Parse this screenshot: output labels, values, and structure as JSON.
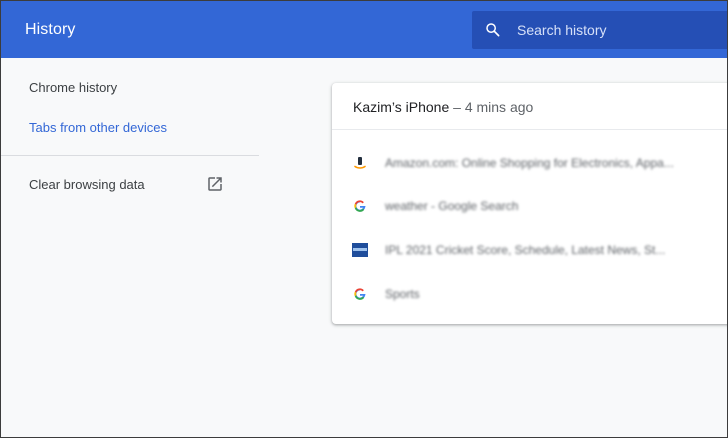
{
  "header": {
    "title": "History",
    "search_placeholder": "Search history"
  },
  "sidebar": {
    "items": [
      {
        "label": "Chrome history",
        "selected": false
      },
      {
        "label": "Tabs from other devices",
        "selected": true
      },
      {
        "label": "Clear browsing data",
        "icon": "open-in-new-icon"
      }
    ]
  },
  "device": {
    "name": "Kazim’s iPhone",
    "time": " – 4 mins ago",
    "tabs": [
      {
        "title": "Amazon.com: Online Shopping for Electronics, Appa...",
        "icon": "amazon-favicon"
      },
      {
        "title": "weather - Google Search",
        "icon": "google-favicon"
      },
      {
        "title": "IPL 2021 Cricket Score, Schedule, Latest News, St...",
        "icon": "cricket-site-favicon"
      },
      {
        "title": "Sports",
        "icon": "google-favicon"
      }
    ]
  },
  "colors": {
    "header_bg": "#3367d6",
    "search_bg": "#254fb5",
    "accent": "#3367d6"
  }
}
